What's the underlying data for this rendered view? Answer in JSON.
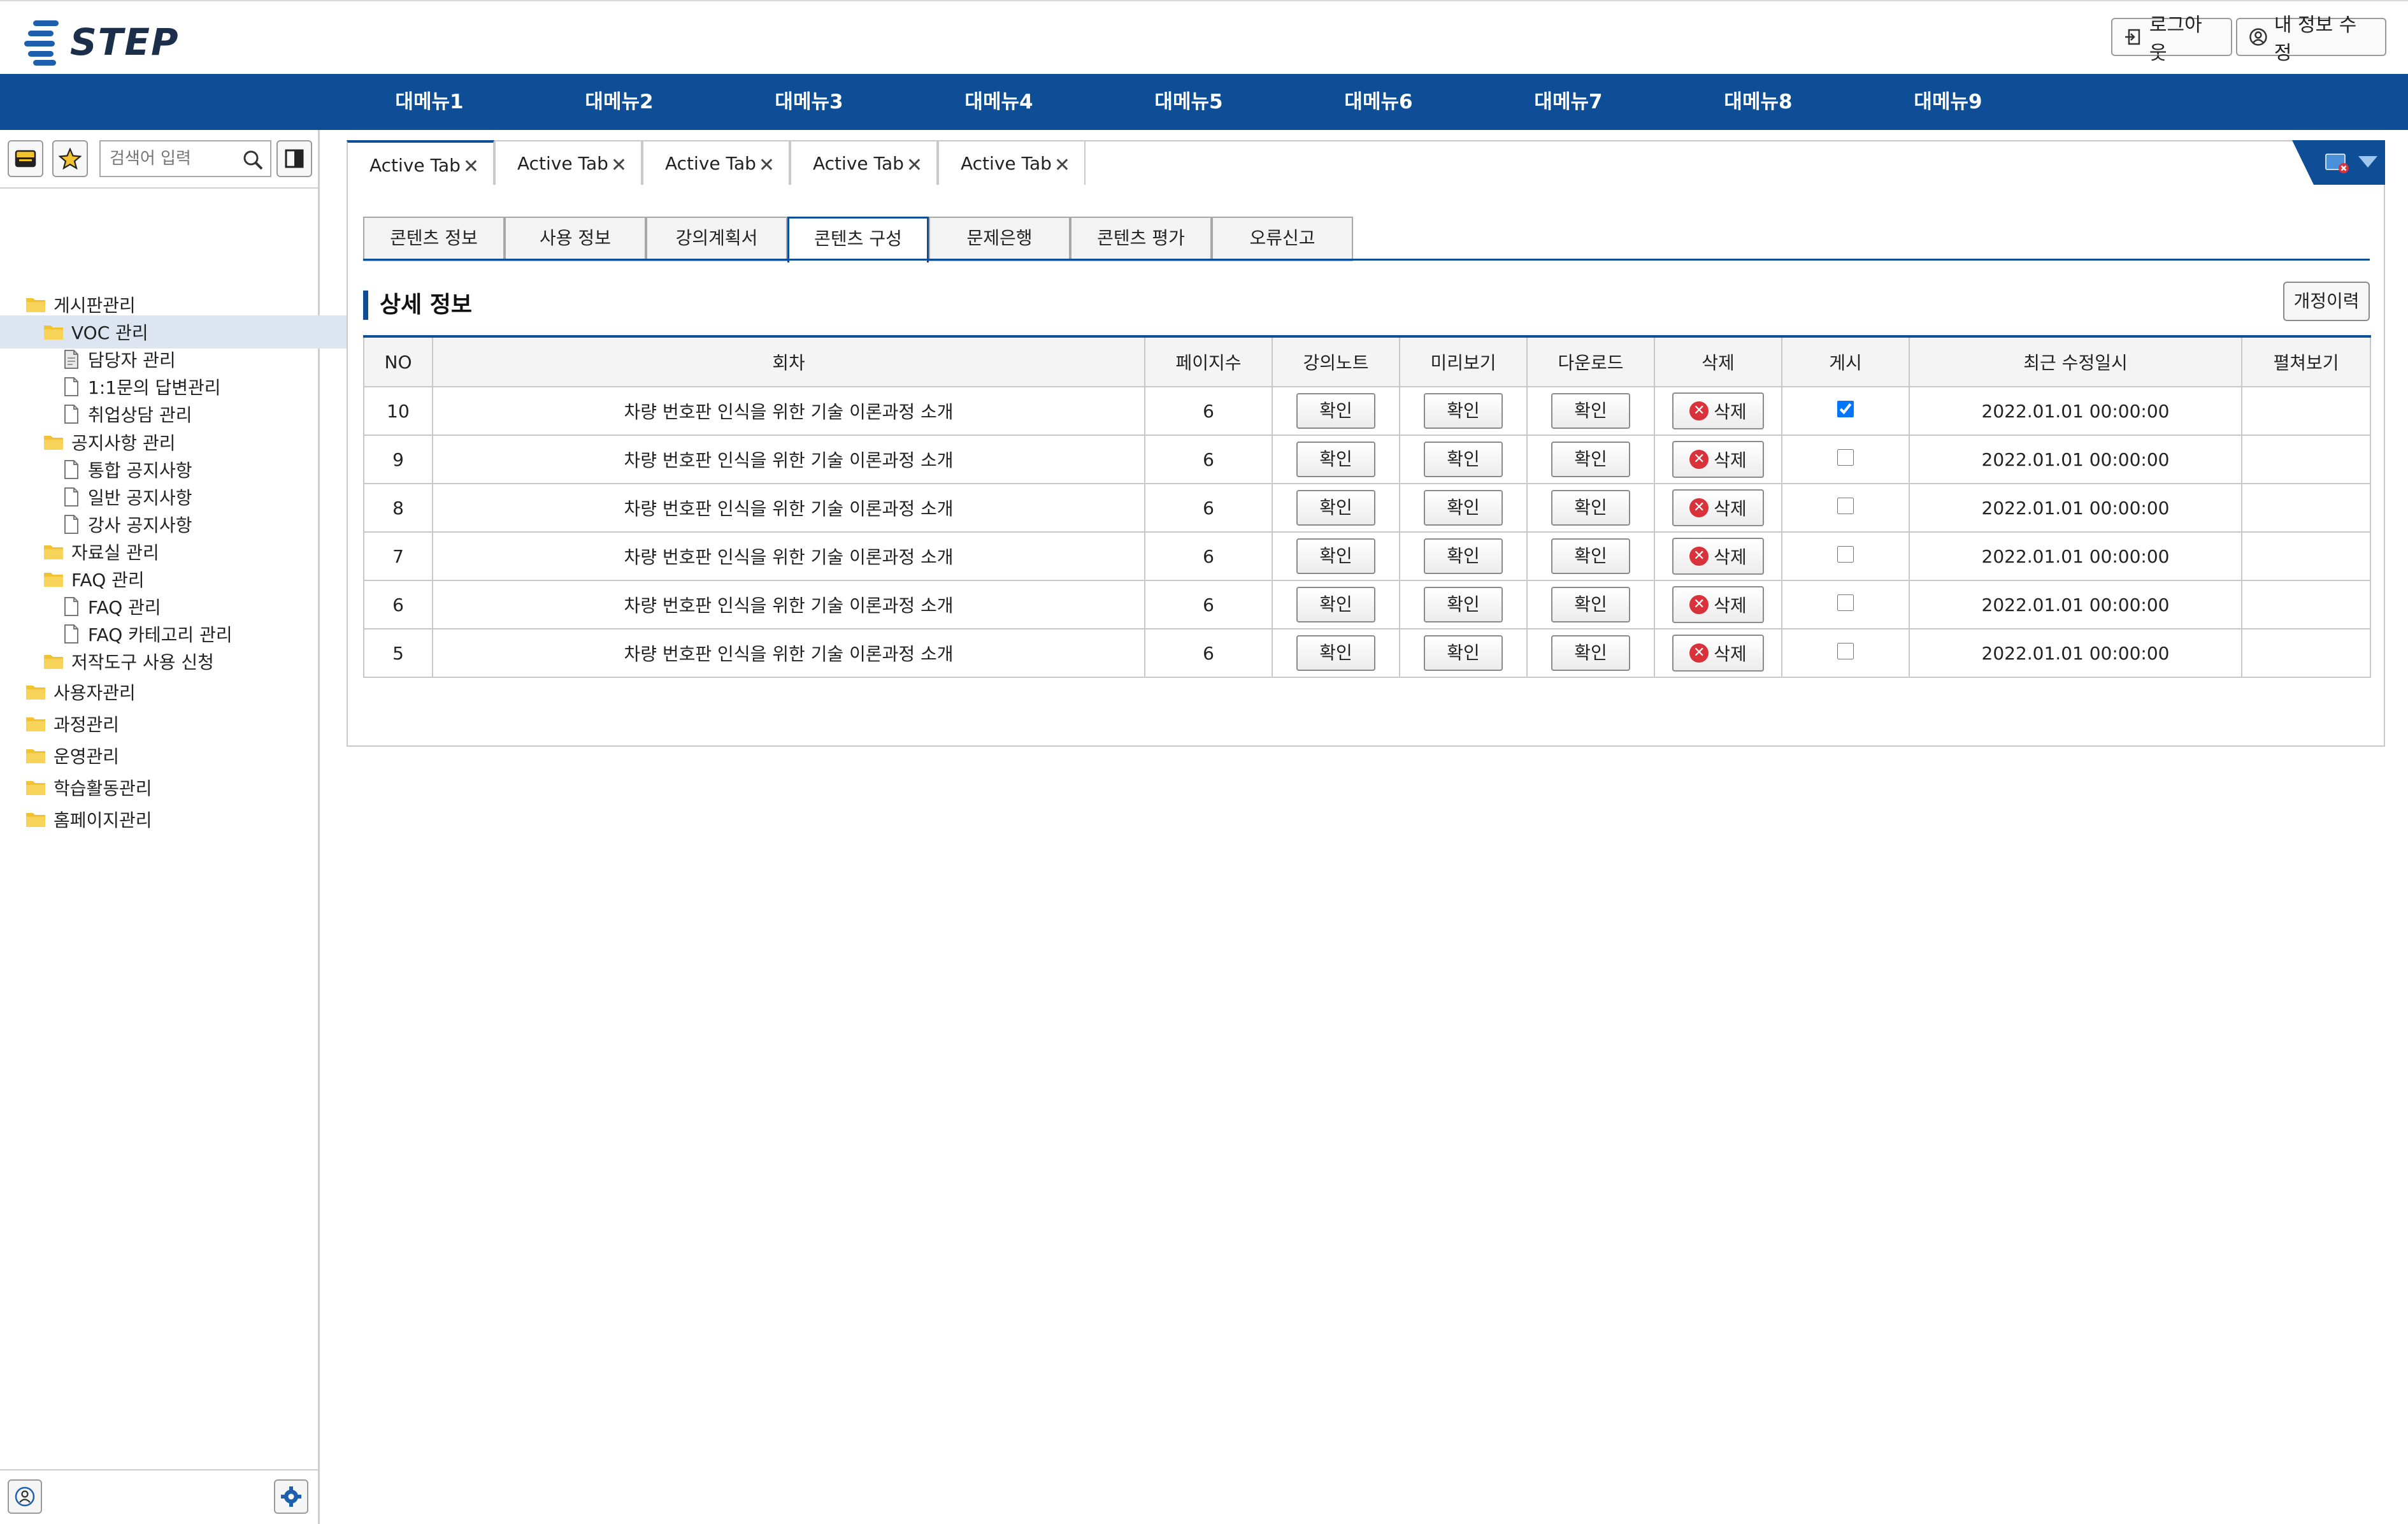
{
  "header": {
    "logo_text": "STEP",
    "logout_label": "로그아웃",
    "profile_label": "내 정보 수정"
  },
  "gnb": [
    "대메뉴1",
    "대메뉴2",
    "대메뉴3",
    "대메뉴4",
    "대메뉴5",
    "대메뉴6",
    "대메뉴7",
    "대메뉴8",
    "대메뉴9"
  ],
  "sidebar": {
    "search_placeholder": "검색어 입력",
    "tree": [
      {
        "label": "게시판관리",
        "type": "folder",
        "level": 0,
        "selected": false
      },
      {
        "label": "VOC 관리",
        "type": "folder",
        "level": 1,
        "selected": true
      },
      {
        "label": "담당자 관리",
        "type": "doc",
        "level": 2,
        "starred": true
      },
      {
        "label": "1:1문의 답변관리",
        "type": "doc",
        "level": 2,
        "starred": false
      },
      {
        "label": "취업상담 관리",
        "type": "doc",
        "level": 2,
        "starred": false
      },
      {
        "label": "공지사항 관리",
        "type": "folder",
        "level": 1
      },
      {
        "label": "통합 공지사항",
        "type": "doc",
        "level": 2,
        "starred": false
      },
      {
        "label": "일반 공지사항",
        "type": "doc",
        "level": 2,
        "starred": false
      },
      {
        "label": "강사 공지사항",
        "type": "doc",
        "level": 2,
        "starred": false
      },
      {
        "label": "자료실 관리",
        "type": "folder",
        "level": 1
      },
      {
        "label": "FAQ 관리",
        "type": "folder",
        "level": 1
      },
      {
        "label": "FAQ 관리",
        "type": "doc",
        "level": 2,
        "starred": false
      },
      {
        "label": "FAQ 카테고리 관리",
        "type": "doc",
        "level": 2,
        "starred": false
      },
      {
        "label": "저작도구 사용 신청",
        "type": "folder",
        "level": 1
      },
      {
        "label": "사용자관리",
        "type": "folder",
        "level": 0
      },
      {
        "label": "과정관리",
        "type": "folder",
        "level": 0
      },
      {
        "label": "운영관리",
        "type": "folder",
        "level": 0
      },
      {
        "label": "학습활동관리",
        "type": "folder",
        "level": 0
      },
      {
        "label": "홈페이지관리",
        "type": "folder",
        "level": 0
      }
    ]
  },
  "window_tabs": [
    "Active Tab",
    "Active Tab",
    "Active Tab",
    "Active Tab",
    "Active Tab"
  ],
  "content_tabs": [
    "콘텐츠 정보",
    "사용 정보",
    "강의계획서",
    "콘텐츠 구성",
    "문제은행",
    "콘텐츠 평가",
    "오류신고"
  ],
  "active_content_tab": 3,
  "section_title": "상세 정보",
  "revision_button": "개정이력",
  "table": {
    "headers": [
      "NO",
      "회차",
      "페이지수",
      "강의노트",
      "미리보기",
      "다운로드",
      "삭제",
      "게시",
      "최근 수정일시",
      "펼쳐보기"
    ],
    "confirm_label": "확인",
    "delete_label": "삭제",
    "rows": [
      {
        "no": "10",
        "title": "차량 번호판 인식을 위한 기술 이론과정 소개",
        "pages": "6",
        "posted": true,
        "date": "2022.01.01 00:00:00"
      },
      {
        "no": "9",
        "title": "차량 번호판 인식을 위한 기술 이론과정 소개",
        "pages": "6",
        "posted": false,
        "date": "2022.01.01 00:00:00"
      },
      {
        "no": "8",
        "title": "차량 번호판 인식을 위한 기술 이론과정 소개",
        "pages": "6",
        "posted": false,
        "date": "2022.01.01 00:00:00"
      },
      {
        "no": "7",
        "title": "차량 번호판 인식을 위한 기술 이론과정 소개",
        "pages": "6",
        "posted": false,
        "date": "2022.01.01 00:00:00"
      },
      {
        "no": "6",
        "title": "차량 번호판 인식을 위한 기술 이론과정 소개",
        "pages": "6",
        "posted": false,
        "date": "2022.01.01 00:00:00"
      },
      {
        "no": "5",
        "title": "차량 번호판 인식을 위한 기술 이론과정 소개",
        "pages": "6",
        "posted": false,
        "date": "2022.01.01 00:00:00"
      }
    ]
  },
  "colors": {
    "primary": "#0d4e96",
    "folder": "#f2c230",
    "delete": "#d9323a"
  }
}
